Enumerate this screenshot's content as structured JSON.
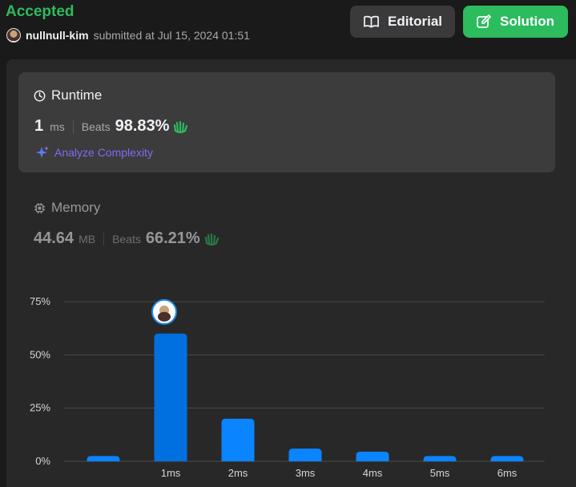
{
  "header": {
    "status": "Accepted",
    "username": "nullnull-kim",
    "submitted_text": "submitted at Jul 15, 2024 01:51",
    "editorial_label": "Editorial",
    "solution_label": "Solution"
  },
  "runtime": {
    "title": "Runtime",
    "value": "1",
    "unit": "ms",
    "beats_label": "Beats",
    "beats_value": "98.83%",
    "analyze_label": "Analyze Complexity"
  },
  "memory": {
    "title": "Memory",
    "value": "44.64",
    "unit": "MB",
    "beats_label": "Beats",
    "beats_value": "66.21%"
  },
  "colors": {
    "accepted": "#2cbb5d",
    "bar": "#0a84ff",
    "bar_highlight": "#0070e0",
    "analyze": "#7e6cf5"
  },
  "chart_data": {
    "type": "bar",
    "categories": [
      "",
      "1ms",
      "2ms",
      "3ms",
      "4ms",
      "5ms",
      "6ms"
    ],
    "values": [
      2.5,
      60,
      20,
      6,
      4.5,
      2.5,
      2.5
    ],
    "highlight_index": 1,
    "ylim": [
      0,
      75
    ],
    "yticks": [
      "0%",
      "25%",
      "50%",
      "75%"
    ],
    "grid": true
  }
}
